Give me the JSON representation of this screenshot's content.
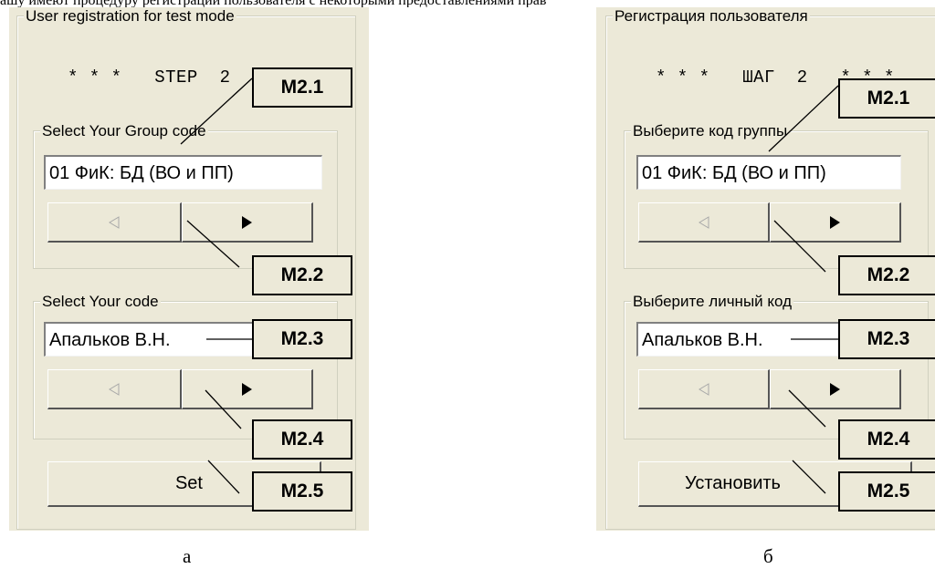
{
  "page": {
    "top_text": "ашу имеют процедуру регистрации пользователя с некоторыми предоставлениями прав"
  },
  "panel_a": {
    "title": "User registration for test mode",
    "step": "* * *   STEP  2   * * *",
    "group_legend": "Select Your Group code",
    "group_value": "01 ФиК: БД (ВО и ПП)",
    "code_legend": "Select Your code",
    "code_value": "Апальков В.Н.",
    "set_label": "Set",
    "caption": "а"
  },
  "panel_b": {
    "title": "Регистрация пользователя",
    "step": "* * *   ШАГ  2   * * *",
    "group_legend": "Выберите код группы",
    "group_value": "01 ФиК: БД (ВО и ПП)",
    "code_legend": "Выберите личный код",
    "code_value": "Апальков В.Н.",
    "set_label": "Установить",
    "caption": "б"
  },
  "callouts": {
    "m21": "M2.1",
    "m22": "M2.2",
    "m23": "M2.3",
    "m24": "M2.4",
    "m25": "M2.5"
  },
  "icons": {
    "prev": "triangle-left-icon",
    "next": "triangle-right-icon"
  }
}
